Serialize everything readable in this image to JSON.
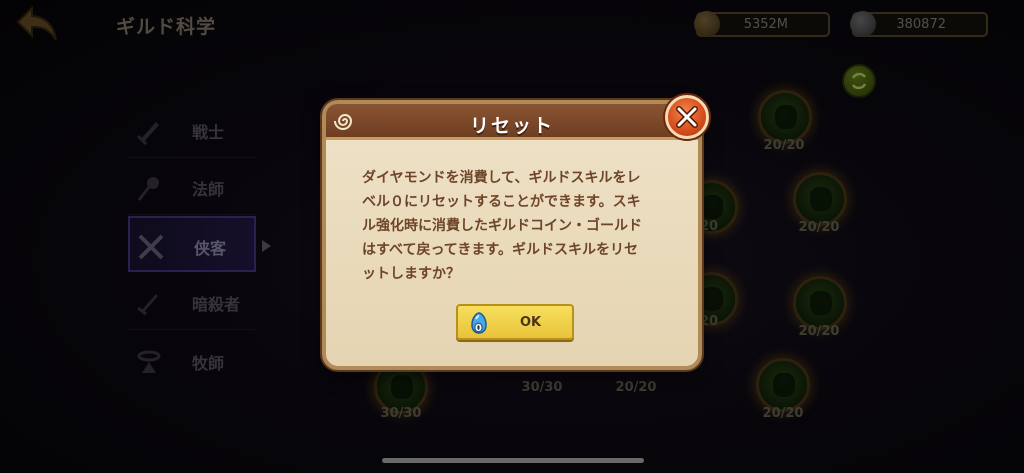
{
  "header": {
    "title": "ギルド科学"
  },
  "resources": {
    "gold": "5352M",
    "guild_coin": "380872"
  },
  "class_tabs": [
    {
      "label": "戦士",
      "icon": "sword-icon"
    },
    {
      "label": "法師",
      "icon": "staff-icon"
    },
    {
      "label": "侠客",
      "icon": "crossed-blades-icon",
      "selected": true
    },
    {
      "label": "暗殺者",
      "icon": "dagger-icon"
    },
    {
      "label": "牧師",
      "icon": "halo-icon"
    }
  ],
  "skill_nodes": [
    {
      "count": "20/20"
    },
    {
      "count": "20/20"
    },
    {
      "count": "20"
    },
    {
      "count": "20"
    },
    {
      "count": "20/20"
    },
    {
      "count": "30/30"
    },
    {
      "count": "30/30"
    },
    {
      "count": "20/20"
    },
    {
      "count": "20/20"
    }
  ],
  "modal": {
    "title": "リセット",
    "body": "ダイヤモンドを消費して、ギルドスキルをレ\nベル０にリセットすることができます。スキ\nル強化時に消費したギルドコイン・ゴールド\nはすべて戻ってきます。ギルドスキルをリセ\nットしますか？",
    "ok_label": "OK",
    "cost_count": "0",
    "cost_icon": "diamond-icon"
  },
  "colors": {
    "modal_bg": "#efe2c7",
    "modal_header": "#7a4628",
    "ok_button": "#f0d04a",
    "close_button": "#d8501e"
  }
}
